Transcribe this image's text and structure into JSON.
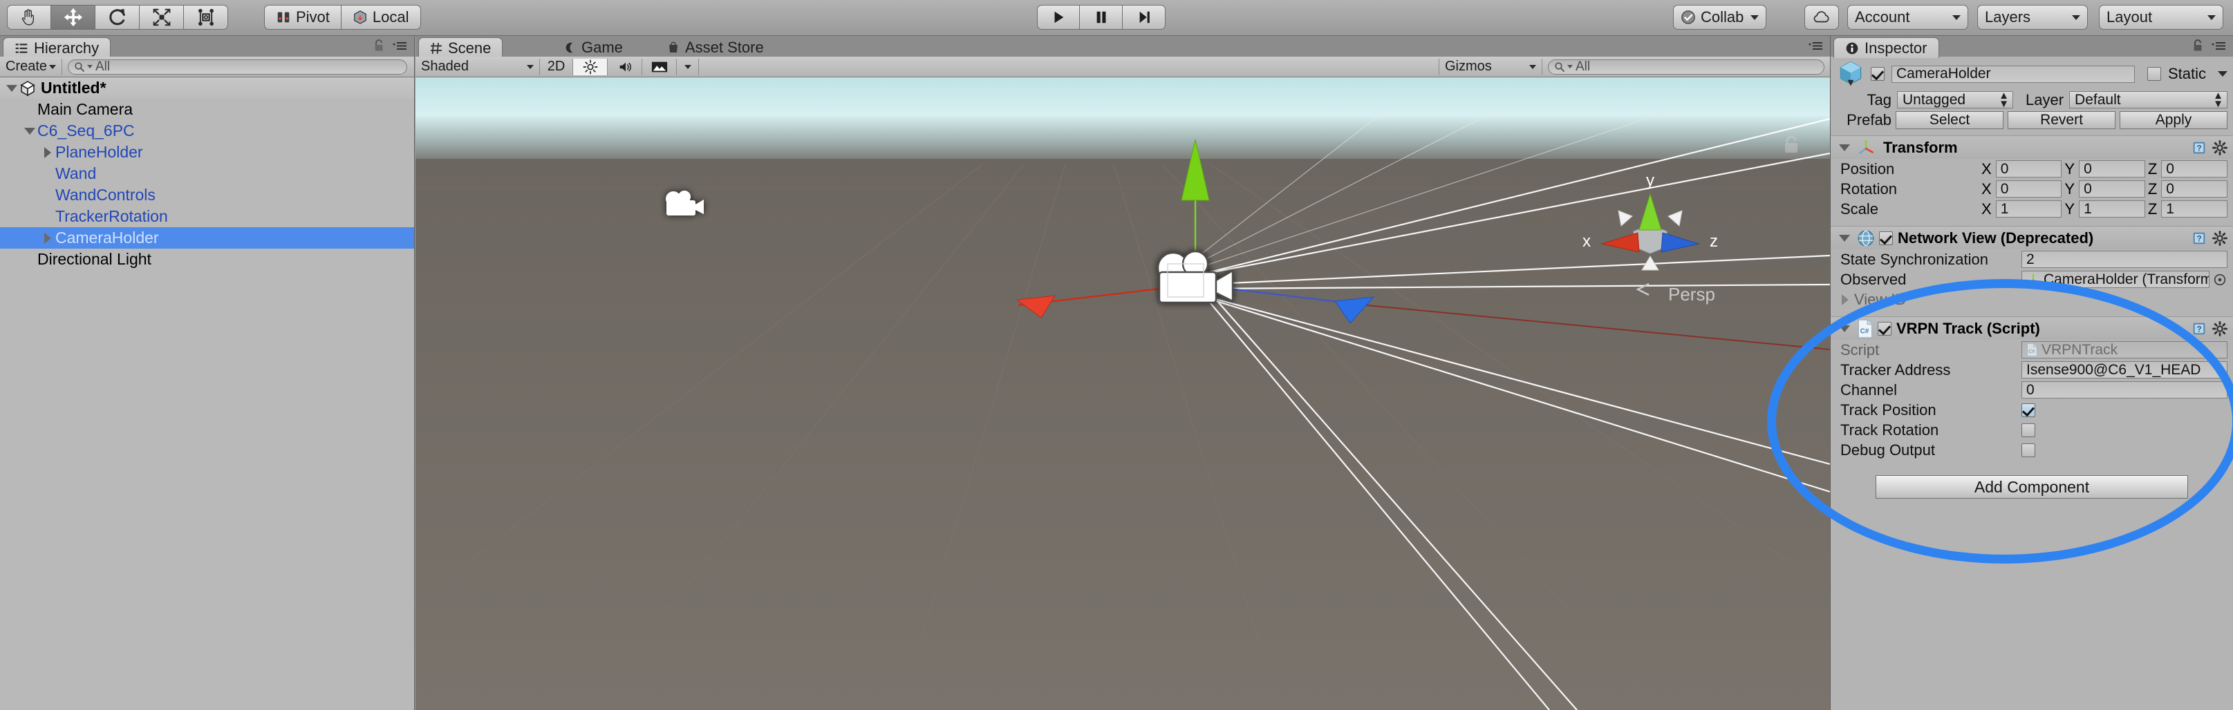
{
  "toolbar": {
    "tools": [
      {
        "name": "hand-tool",
        "icon": "hand-icon",
        "active": false
      },
      {
        "name": "move-tool",
        "icon": "move-icon",
        "active": true
      },
      {
        "name": "rotate-tool",
        "icon": "rotate-icon",
        "active": false
      },
      {
        "name": "scale-tool",
        "icon": "scale-icon",
        "active": false
      },
      {
        "name": "rect-tool",
        "icon": "rect-transform-icon",
        "active": false
      }
    ],
    "pivot_label": "Pivot",
    "local_label": "Local",
    "play_label": "Play",
    "pause_label": "Pause",
    "step_label": "Step",
    "collab_label": "Collab",
    "cloud_label": "",
    "account_label": "Account",
    "layers_label": "Layers",
    "layout_label": "Layout"
  },
  "hierarchy": {
    "tab_label": "Hierarchy",
    "create_label": "Create",
    "search_placeholder": "All",
    "items": [
      {
        "label": "Untitled*",
        "depth": 0,
        "twirl": "down",
        "color": "black",
        "bold": true,
        "icon": "unity-scene-icon",
        "selected": false
      },
      {
        "label": "Main Camera",
        "depth": 1,
        "twirl": "none",
        "color": "black",
        "bold": false,
        "selected": false
      },
      {
        "label": "C6_Seq_6PC",
        "depth": 1,
        "twirl": "down",
        "color": "blue",
        "bold": false,
        "selected": false
      },
      {
        "label": "PlaneHolder",
        "depth": 2,
        "twirl": "right",
        "color": "blue",
        "bold": false,
        "selected": false
      },
      {
        "label": "Wand",
        "depth": 2,
        "twirl": "none",
        "color": "blue",
        "bold": false,
        "selected": false
      },
      {
        "label": "WandControls",
        "depth": 2,
        "twirl": "none",
        "color": "blue",
        "bold": false,
        "selected": false
      },
      {
        "label": "TrackerRotation",
        "depth": 2,
        "twirl": "none",
        "color": "blue",
        "bold": false,
        "selected": false
      },
      {
        "label": "CameraHolder",
        "depth": 2,
        "twirl": "right",
        "color": "blue",
        "bold": false,
        "selected": true
      },
      {
        "label": "Directional Light",
        "depth": 1,
        "twirl": "none",
        "color": "black",
        "bold": false,
        "selected": false
      }
    ]
  },
  "scene": {
    "tabs": [
      {
        "label": "Scene",
        "icon": "grid-icon",
        "active": true
      },
      {
        "label": "Game",
        "icon": "gamepad-icon",
        "active": false
      },
      {
        "label": "Asset Store",
        "icon": "store-icon",
        "active": false
      }
    ],
    "shading_mode": "Shaded",
    "mode_2d": "2D",
    "gizmos_label": "Gizmos",
    "gizmos_search_placeholder": "All",
    "axis_x": "x",
    "axis_y": "y",
    "axis_z": "z",
    "projection_label": "Persp"
  },
  "inspector": {
    "tab_label": "Inspector",
    "object_name": "CameraHolder",
    "enabled": true,
    "static_label": "Static",
    "tag_label": "Tag",
    "tag_value": "Untagged",
    "layer_label": "Layer",
    "layer_value": "Default",
    "prefab_label": "Prefab",
    "prefab_buttons": [
      "Select",
      "Revert",
      "Apply"
    ],
    "components": [
      {
        "name": "Transform",
        "has_checkbox": false,
        "icon": "transform-axis-icon",
        "rows": [
          {
            "label": "Position",
            "type": "vector3",
            "x": "0",
            "y": "0",
            "z": "0"
          },
          {
            "label": "Rotation",
            "type": "vector3",
            "x": "0",
            "y": "0",
            "z": "0"
          },
          {
            "label": "Scale",
            "type": "vector3",
            "x": "1",
            "y": "1",
            "z": "1"
          }
        ]
      },
      {
        "name": "Network View (Deprecated)",
        "has_checkbox": true,
        "checked": true,
        "icon": "network-globe-icon",
        "rows": [
          {
            "label": "State Synchronization",
            "type": "text",
            "value": "2"
          },
          {
            "label": "Observed",
            "type": "object",
            "value": "CameraHolder (Transform)"
          },
          {
            "label": "View ID",
            "type": "foldout",
            "value": ""
          }
        ]
      },
      {
        "name": "VRPN Track (Script)",
        "has_checkbox": true,
        "checked": true,
        "icon": "csharp-script-icon",
        "rows": [
          {
            "label": "Script",
            "type": "script",
            "value": "VRPNTrack"
          },
          {
            "label": "Tracker Address",
            "type": "text",
            "value": "Isense900@C6_V1_HEAD"
          },
          {
            "label": "Channel",
            "type": "text",
            "value": "0"
          },
          {
            "label": "Track Position",
            "type": "bool",
            "value": true
          },
          {
            "label": "Track Rotation",
            "type": "bool",
            "value": false
          },
          {
            "label": "Debug Output",
            "type": "bool",
            "value": false
          }
        ]
      }
    ],
    "add_component_label": "Add Component"
  },
  "colors": {
    "selection_blue": "#4f8bea",
    "highlight_ellipse": "#2f83f0",
    "hierarchy_blue_text": "#2046b6",
    "axis_x": "#e8402a",
    "axis_y": "#76d117",
    "axis_z": "#2a6ee8"
  }
}
